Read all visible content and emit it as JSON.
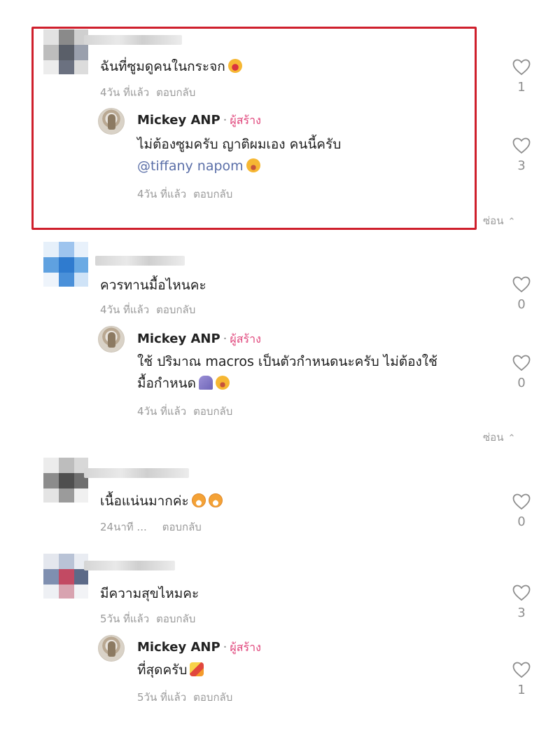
{
  "comments": [
    {
      "text": "ฉันที่ซูมดูคนในกระจก",
      "emoji": "grinning-face",
      "time": "4วัน ที่แล้ว",
      "reply_label": "ตอบกลับ",
      "likes": "1",
      "avatar_colors": [
        "#8a8a8a",
        "#5a5f69",
        "#c9c9c9",
        "#6b7180",
        "#e3e3e3",
        "#9aa0ad"
      ],
      "highlighted": true,
      "reply": {
        "author": "Mickey ANP",
        "role": "ผู้สร้าง",
        "line1": "ไม่ต้องซูมครับ ญาติผมเอง คนนี้ครับ",
        "mention": "@tiffany napom",
        "time": "4วัน ที่แล้ว",
        "reply_label": "ตอบกลับ",
        "likes": "3"
      },
      "hide_label": "ซ่อน"
    },
    {
      "text": "ควรทานมื้อไหนคะ",
      "time": "4วัน ที่แล้ว",
      "reply_label": "ตอบกลับ",
      "likes": "0",
      "avatar_colors": [
        "#4a90d9",
        "#9ec4ee",
        "#2f7bcf",
        "#cfe3f7",
        "#5fa1e0",
        "#e6f0fa"
      ],
      "reply": {
        "author": "Mickey ANP",
        "role": "ผู้สร้าง",
        "line1": "ใช้ ปริมาณ macros เป็นตัวกำหนดนะครับ ไม่ต้องใช้",
        "line2": "มื้อกำหนด",
        "time": "4วัน ที่แล้ว",
        "reply_label": "ตอบกลับ",
        "likes": "0"
      },
      "hide_label": "ซ่อน"
    },
    {
      "text": "เนื้อแน่นมากค่ะ",
      "time": "24นาที ...",
      "reply_label": "ตอบกลับ",
      "likes": "0",
      "avatar_colors": [
        "#6f6f6f",
        "#bdbdbd",
        "#4f4f4f",
        "#d8d8d8",
        "#8c8c8c",
        "#ececec"
      ]
    },
    {
      "text": "มีความสุขไหมคะ",
      "time": "5วัน ที่แล้ว",
      "reply_label": "ตอบกลับ",
      "likes": "3",
      "avatar_colors": [
        "#7f8fb0",
        "#c24a63",
        "#b9c3d6",
        "#e4e7ee",
        "#5c6a88",
        "#d8a3b0"
      ],
      "reply": {
        "author": "Mickey ANP",
        "role": "ผู้สร้าง",
        "line1": "ที่สุดครับ",
        "time": "5วัน ที่แล้ว",
        "reply_label": "ตอบกลับ",
        "likes": "1"
      }
    }
  ],
  "colors": {
    "highlight": "#cf1f2c",
    "creator_role": "#e0457b",
    "mention": "#5b6fa8",
    "meta": "#9a9a9a"
  },
  "icons": {
    "like": "heart-outline-icon",
    "hide": "chevron-up-icon",
    "avatar": "pixelated-avatar"
  }
}
